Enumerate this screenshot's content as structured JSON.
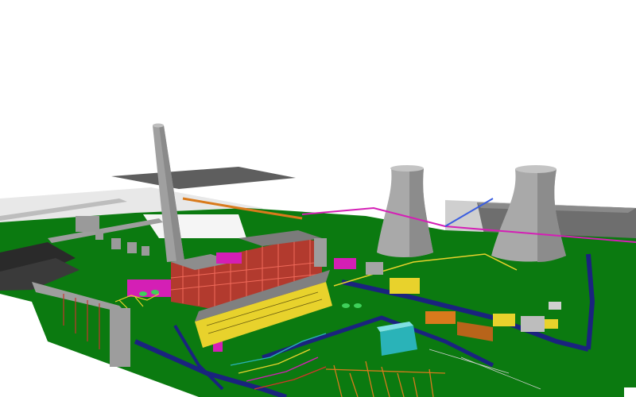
{
  "scene": {
    "background_color": "#ffffff",
    "ground_color": "#0b7a10",
    "road_color": "#1a237e",
    "concrete_color": "#a8a8a8",
    "steel_red": "#d0362a",
    "accent_magenta": "#d41fb5",
    "accent_yellow": "#e8d22c",
    "accent_cyan": "#2ab3b8",
    "accent_orange": "#d97a1c"
  }
}
